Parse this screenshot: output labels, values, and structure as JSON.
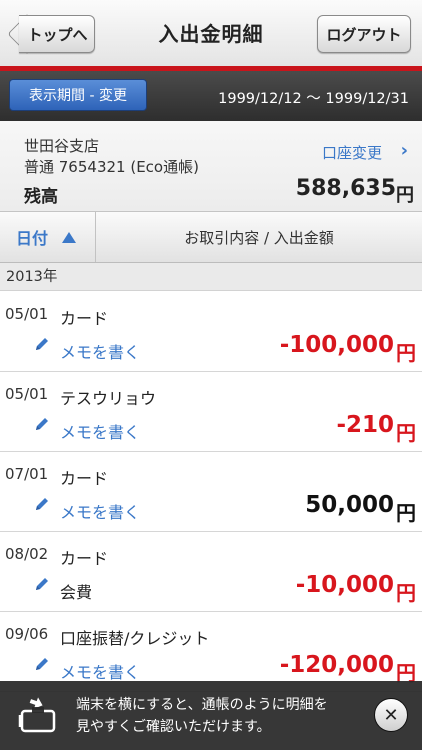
{
  "header": {
    "back_label": "トップへ",
    "title": "入出金明細",
    "logout_label": "ログアウト"
  },
  "colors": {
    "brand_red": "#c9141b",
    "link_blue": "#3b78c8",
    "negative_red": "#d8161d",
    "period_button_blue": "#2e63b8"
  },
  "period": {
    "button_label": "表示期間 - 変更",
    "range": "1999/12/12 ～ 1999/12/31"
  },
  "account": {
    "branch": "世田谷支店",
    "number": "普通 7654321 (Eco通帳)",
    "balance_label": "残高",
    "change_label": "口座変更",
    "balance_value": "588,635",
    "balance_unit": "円"
  },
  "sort": {
    "date_label": "日付",
    "content_label": "お取引内容 / 入出金額"
  },
  "year": "2013年",
  "transactions": [
    {
      "date": "05/01",
      "desc": "カード",
      "memo": "メモを書く",
      "amount": "-100,000",
      "unit": "円"
    },
    {
      "date": "05/01",
      "desc": "テスウリョウ",
      "memo": "メモを書く",
      "amount": "-210",
      "unit": "円"
    },
    {
      "date": "07/01",
      "desc": "カード",
      "memo": "メモを書く",
      "amount": "50,000",
      "unit": "円"
    },
    {
      "date": "08/02",
      "desc": "カード",
      "memo": "会費",
      "amount": "-10,000",
      "unit": "円"
    },
    {
      "date": "09/06",
      "desc": "口座振替/クレジット",
      "memo": "メモを書く",
      "amount": "-120,000",
      "unit": "円"
    }
  ],
  "banner": {
    "line1": "端末を横にすると、通帳のように明細を",
    "line2": "見やすくご確認いただけます。",
    "close_glyph": "✕"
  },
  "icons": {
    "chevron_right": "›"
  }
}
